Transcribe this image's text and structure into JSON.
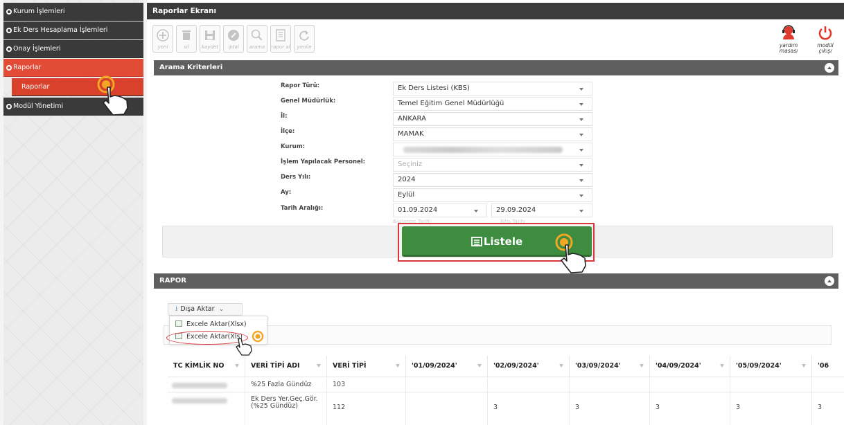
{
  "sidebar": {
    "items": [
      {
        "label": "Kurum İşlemleri"
      },
      {
        "label": "Ek Ders Hesaplama İşlemleri"
      },
      {
        "label": "Onay İşlemleri"
      },
      {
        "label": "Raporlar"
      },
      {
        "label": "Raporlar"
      },
      {
        "label": "Modül Yönetimi"
      }
    ]
  },
  "page": {
    "title": "Raporlar Ekranı"
  },
  "toolbar": {
    "buttons": [
      {
        "label": "yeni",
        "icon": "plus-circle-icon"
      },
      {
        "label": "sil",
        "icon": "trash-icon"
      },
      {
        "label": "kaydet",
        "icon": "save-icon"
      },
      {
        "label": "iptal",
        "icon": "cancel-icon"
      },
      {
        "label": "arama",
        "icon": "search-icon"
      },
      {
        "label": "rapor al",
        "icon": "report-icon"
      },
      {
        "label": "yenile",
        "icon": "refresh-icon"
      }
    ],
    "help": {
      "line1": "yardım",
      "line2": "masası",
      "icon": "headset-icon"
    },
    "exit": {
      "line1": "modül",
      "line2": "çıkışı",
      "icon": "power-icon"
    }
  },
  "search": {
    "header": "Arama Kriterleri",
    "fields": [
      {
        "label": "Rapor Türü:",
        "value": "Ek Ders Listesi (KBS)"
      },
      {
        "label": "Genel Müdürlük:",
        "value": "Temel Eğitim Genel Müdürlüğü"
      },
      {
        "label": "İl:",
        "value": "ANKARA"
      },
      {
        "label": "İlçe:",
        "value": "MAMAK"
      },
      {
        "label": "Kurum:",
        "value": ""
      },
      {
        "label": "İşlem Yapılacak Personel:",
        "value": "Seçiniz"
      },
      {
        "label": "Ders Yılı:",
        "value": "2024"
      },
      {
        "label": "Ay:",
        "value": "Eylül"
      }
    ],
    "date_range": {
      "label": "Tarih Aralığı:",
      "start": "01.09.2024",
      "end": "29.09.2024",
      "start_hint": "Başlangıç Tarihi",
      "end_hint": "Bitiş Tarihi"
    },
    "list_button": "Listele"
  },
  "report": {
    "header": "RAPOR",
    "export_button": "Dışa Aktar",
    "export_options": [
      "Excele Aktar(Xlsx)",
      "Excele Aktar(Xls)"
    ],
    "columns": [
      "TC KİMLİK NO",
      "VERİ TİPİ ADI",
      "VERİ TİPİ",
      "'01/09/2024'",
      "'02/09/2024'",
      "'03/09/2024'",
      "'04/09/2024'",
      "'05/09/2024'",
      "'06"
    ],
    "rows": [
      {
        "tc": "",
        "veri_tipi_adi": "%25 Fazla Gündüz",
        "veri_tipi": "103",
        "d01": "",
        "d02": "",
        "d03": "",
        "d04": "",
        "d05": "",
        "d06": ""
      },
      {
        "tc": "",
        "veri_tipi_adi": "Ek Ders Yer.Geç.Gör.(%25 Gündüz)",
        "veri_tipi": "112",
        "d01": "",
        "d02": "3",
        "d03": "3",
        "d04": "3",
        "d05": "3",
        "d06": "3"
      }
    ]
  },
  "colors": {
    "accent": "#e24b35",
    "dark": "#3a3a3a",
    "success": "#3d8c40",
    "highlight": "#d9363e"
  }
}
